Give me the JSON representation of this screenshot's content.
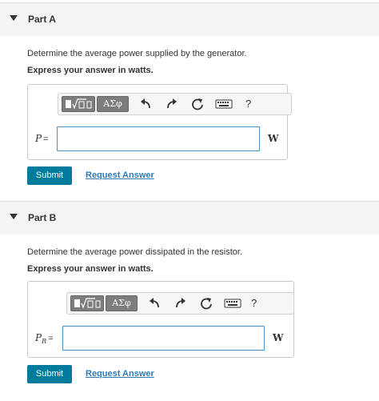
{
  "parts": [
    {
      "title": "Part A",
      "question": "Determine the average power supplied by the generator.",
      "instruction": "Express your answer in watts.",
      "variable": "P",
      "subscript": "",
      "equals": "=",
      "answer_value": "",
      "unit": "W",
      "submit_label": "Submit",
      "request_label": "Request Answer"
    },
    {
      "title": "Part B",
      "question": "Determine the average power dissipated in the resistor.",
      "instruction": "Express your answer in watts.",
      "variable": "P",
      "subscript": "R",
      "equals": "=",
      "answer_value": "",
      "unit": "W",
      "submit_label": "Submit",
      "request_label": "Request Answer"
    }
  ],
  "toolbar": {
    "greek_label": "ΑΣφ",
    "help_label": "?"
  },
  "colors": {
    "submit_bg": "#007b9c",
    "link": "#2e7bb3",
    "input_border": "#4a90c2",
    "header_bg": "#f4f4f4"
  }
}
